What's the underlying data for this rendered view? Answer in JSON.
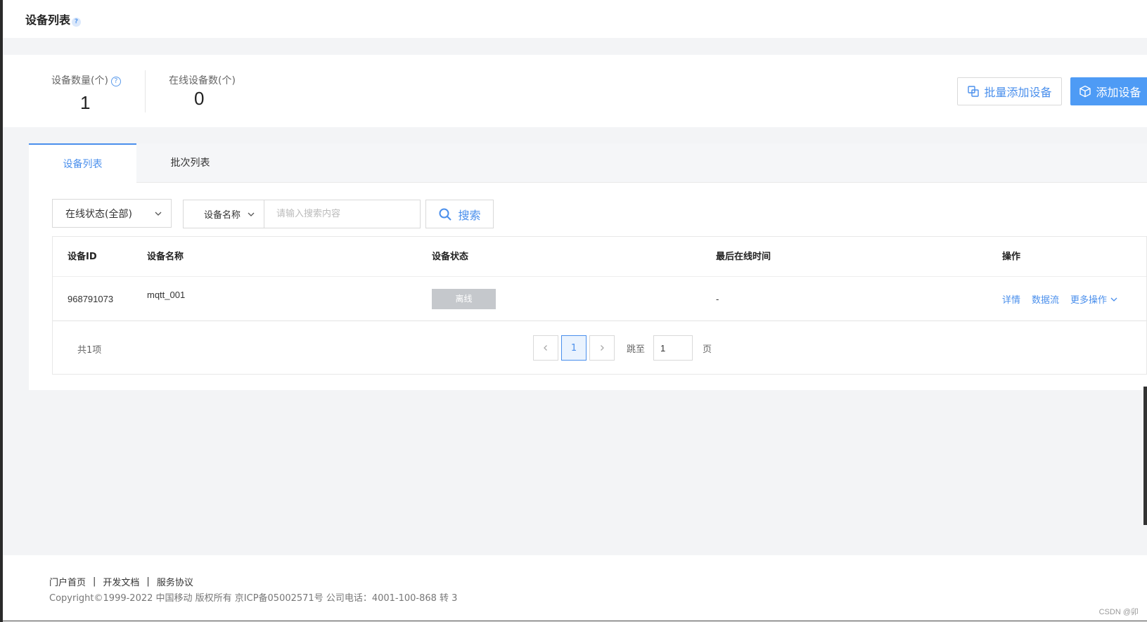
{
  "header": {
    "title": "设备列表",
    "help_glyph": "?"
  },
  "stats": {
    "device_count": {
      "label": "设备数量(个)",
      "help_glyph": "?",
      "value": "1"
    },
    "online_count": {
      "label": "在线设备数(个)",
      "value": "0"
    }
  },
  "actions": {
    "batch_add_label": "批量添加设备",
    "add_label": "添加设备"
  },
  "tabs": [
    {
      "label": "设备列表",
      "active": true
    },
    {
      "label": "批次列表",
      "active": false
    }
  ],
  "filters": {
    "status_select": "在线状态(全部)",
    "field_select": "设备名称",
    "search_placeholder": "请输入搜索内容",
    "search_button": "搜索"
  },
  "table": {
    "columns": [
      "设备ID",
      "设备名称",
      "设备状态",
      "最后在线时间",
      "操作"
    ],
    "rows": [
      {
        "id": "968791073",
        "name": "mqtt_001",
        "status": "离线",
        "last_online": "-",
        "ops": {
          "detail": "详情",
          "datastream": "数据流",
          "more": "更多操作"
        }
      }
    ]
  },
  "pagination": {
    "total_label": "共1项",
    "current_page": "1",
    "jump_label": "跳至",
    "jump_value": "1",
    "page_suffix": "页"
  },
  "footer": {
    "links": [
      "门户首页",
      "开发文档",
      "服务协议"
    ],
    "separator": "|",
    "copyright": "Copyright©1999-2022 中国移动 版权所有 京ICP备05002571号 公司电话：4001-100-868 转 3"
  },
  "watermark": "CSDN @卯",
  "colors": {
    "accent": "#4a8fec",
    "primary_button": "#4e9bf5",
    "offline_badge": "#c5c8cc",
    "background": "#f3f4f6"
  }
}
